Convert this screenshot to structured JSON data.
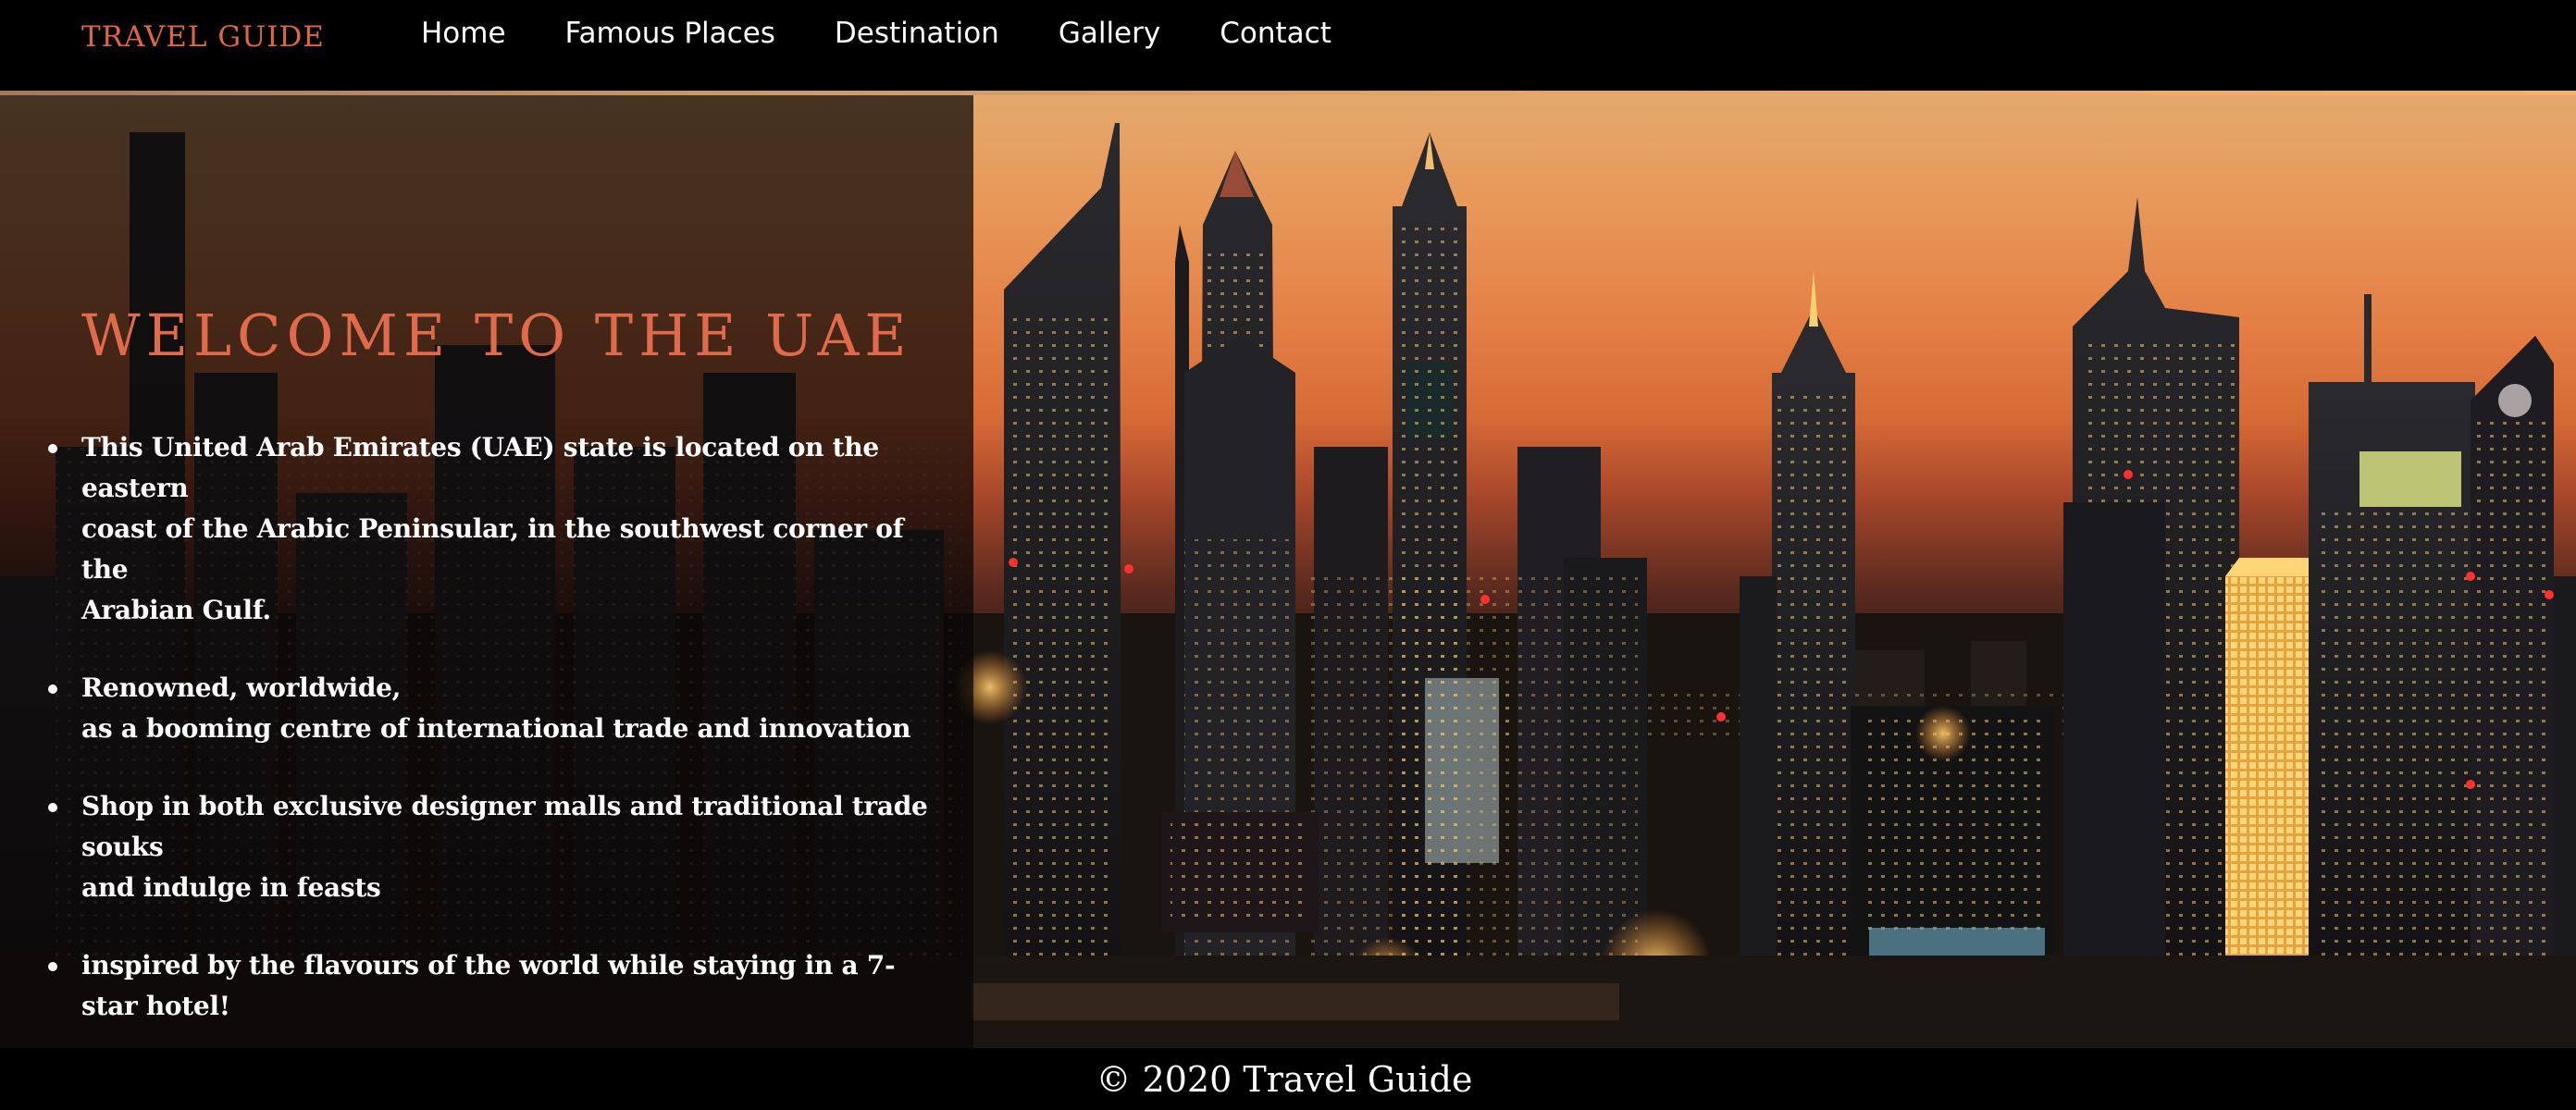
{
  "navbar": {
    "brand": "TRAVEL GUIDE",
    "links": [
      "Home",
      "Famous Places",
      "Destination",
      "Gallery",
      "Contact"
    ]
  },
  "hero": {
    "title": "WELCOME TO THE UAE",
    "facts": [
      [
        "This United Arab Emirates (UAE) state is located on the eastern",
        "coast of the Arabic Peninsular, in the southwest corner of the",
        "Arabian Gulf."
      ],
      [
        "Renowned, worldwide,",
        "as a booming centre of international trade and innovation"
      ],
      [
        "Shop in both exclusive designer malls and traditional trade souks",
        "and indulge in feasts"
      ],
      [
        "inspired by the flavours of the world while staying in a 7-star hotel!"
      ]
    ],
    "background_image": "dubai-skyline-at-dusk"
  },
  "footer": {
    "copyright": "© 2020 Travel Guide"
  },
  "colors": {
    "brand_accent": "#e06640",
    "title_accent": "#e06a4c",
    "navbar_bg": "#000000",
    "sky_top": "#e4a96c",
    "sky_mid": "#d66a36"
  }
}
